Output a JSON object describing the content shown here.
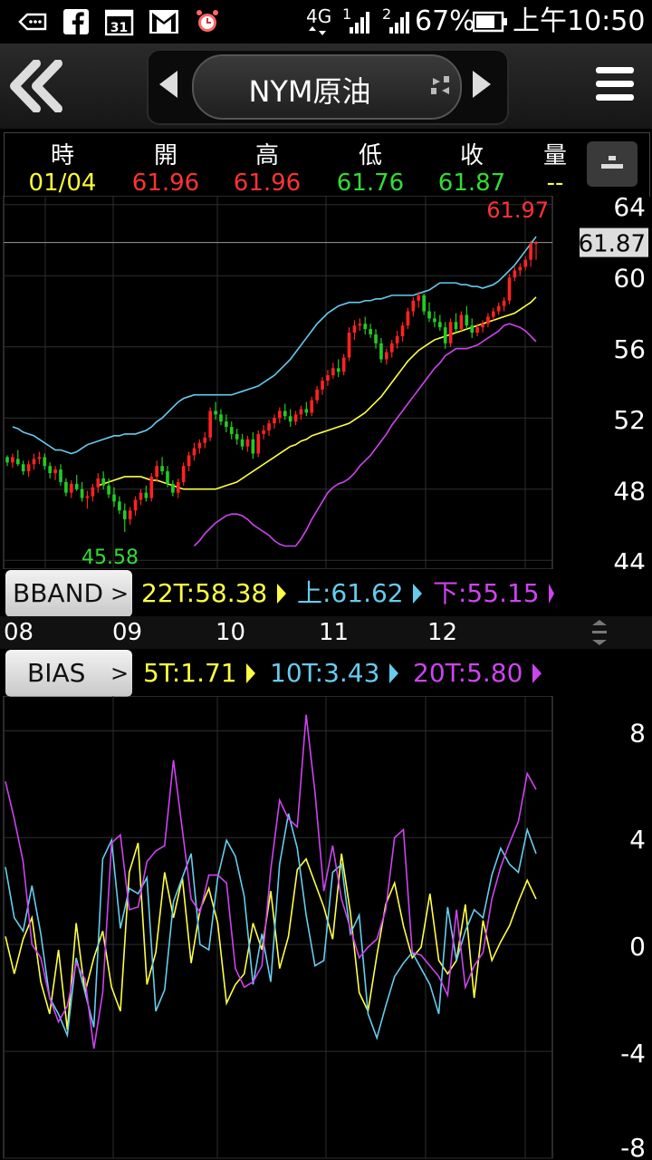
{
  "status_bar": {
    "network": "4G",
    "sim1": "1",
    "sim2": "2",
    "battery": "67%",
    "time": "上午10:50",
    "icons": [
      "cast-icon",
      "facebook-icon",
      "calendar-icon",
      "gmail-icon",
      "alarm-icon"
    ],
    "calendar_day": "31"
  },
  "app_bar": {
    "title": "NYM原油"
  },
  "quote": {
    "headers": [
      "時",
      "開",
      "高",
      "低",
      "收",
      "量"
    ],
    "values": [
      "01/04",
      "61.96",
      "61.96",
      "61.76",
      "61.87",
      "--"
    ],
    "colors": [
      "#ffff33",
      "#ff3333",
      "#ff3333",
      "#33dd33",
      "#33dd33",
      "#ffff33"
    ]
  },
  "bband": {
    "button_label": "BBAND",
    "mid_label": "22T:58.38",
    "up_label": "上:61.62",
    "down_label": "下:55.15",
    "colors": {
      "mid": "#ffff44",
      "up": "#66ccee",
      "down": "#cc44ee"
    }
  },
  "months": [
    "08",
    "09",
    "10",
    "11",
    "12"
  ],
  "bias": {
    "button_label": "BIAS",
    "t5_label": "5T:1.71",
    "t10_label": "10T:3.43",
    "t20_label": "20T:5.80"
  },
  "chart_data": [
    {
      "type": "candlestick",
      "high_label": "61.97",
      "low_label": "45.58",
      "last_price": "61.87",
      "last_value": 61.87,
      "y_ticks": [
        64,
        60,
        56,
        52,
        48,
        44
      ],
      "ylim": [
        43.5,
        64.5
      ],
      "grid": true,
      "up_color": "#ff2222",
      "down_color": "#22cc22",
      "candles": [
        [
          49.8,
          49.9,
          49.3,
          49.5
        ],
        [
          49.5,
          50.0,
          49.2,
          49.8
        ],
        [
          49.7,
          50.2,
          49.3,
          49.4
        ],
        [
          49.4,
          49.6,
          48.8,
          49.0
        ],
        [
          49.0,
          49.6,
          48.7,
          49.4
        ],
        [
          49.4,
          50.0,
          49.1,
          49.7
        ],
        [
          49.7,
          50.1,
          49.4,
          49.8
        ],
        [
          49.8,
          50.0,
          49.1,
          49.3
        ],
        [
          49.3,
          49.5,
          48.6,
          48.9
        ],
        [
          48.9,
          49.3,
          48.5,
          49.1
        ],
        [
          49.1,
          49.4,
          48.2,
          48.4
        ],
        [
          48.4,
          48.6,
          47.6,
          47.8
        ],
        [
          47.8,
          48.5,
          47.5,
          48.3
        ],
        [
          48.3,
          48.8,
          47.9,
          48.0
        ],
        [
          48.0,
          48.4,
          47.3,
          47.5
        ],
        [
          47.5,
          47.9,
          46.9,
          47.6
        ],
        [
          47.6,
          48.3,
          47.3,
          48.1
        ],
        [
          48.1,
          48.9,
          47.8,
          48.6
        ],
        [
          48.6,
          49.0,
          48.0,
          48.2
        ],
        [
          48.2,
          48.6,
          47.5,
          47.7
        ],
        [
          47.7,
          48.1,
          47.0,
          47.3
        ],
        [
          47.3,
          47.6,
          46.6,
          46.8
        ],
        [
          46.8,
          47.2,
          45.58,
          46.3
        ],
        [
          46.3,
          47.0,
          46.0,
          46.8
        ],
        [
          46.8,
          47.6,
          46.5,
          47.4
        ],
        [
          47.4,
          48.0,
          47.1,
          47.8
        ],
        [
          47.8,
          48.2,
          47.3,
          47.5
        ],
        [
          47.5,
          48.9,
          47.3,
          48.7
        ],
        [
          48.7,
          49.6,
          48.4,
          49.3
        ],
        [
          49.3,
          49.8,
          48.8,
          49.0
        ],
        [
          49.0,
          49.3,
          48.1,
          48.3
        ],
        [
          48.3,
          48.5,
          47.6,
          47.8
        ],
        [
          47.8,
          48.6,
          47.5,
          48.4
        ],
        [
          48.4,
          49.5,
          48.2,
          49.3
        ],
        [
          49.3,
          50.1,
          49.0,
          49.9
        ],
        [
          49.9,
          50.6,
          49.6,
          50.3
        ],
        [
          50.3,
          50.8,
          50.0,
          50.6
        ],
        [
          50.6,
          51.2,
          50.3,
          50.9
        ],
        [
          50.9,
          52.6,
          50.7,
          52.4
        ],
        [
          52.4,
          52.9,
          51.9,
          52.2
        ],
        [
          52.2,
          52.5,
          51.6,
          51.8
        ],
        [
          51.8,
          52.2,
          51.2,
          51.5
        ],
        [
          51.5,
          51.8,
          50.8,
          51.1
        ],
        [
          51.1,
          51.4,
          50.5,
          50.8
        ],
        [
          50.8,
          51.1,
          50.2,
          50.4
        ],
        [
          50.4,
          51.0,
          50.1,
          50.8
        ],
        [
          50.8,
          51.2,
          49.7,
          50.0
        ],
        [
          50.0,
          51.3,
          49.8,
          51.1
        ],
        [
          51.1,
          51.6,
          50.8,
          51.3
        ],
        [
          51.3,
          51.9,
          51.0,
          51.7
        ],
        [
          51.7,
          52.2,
          51.4,
          52.0
        ],
        [
          52.0,
          52.6,
          51.7,
          52.4
        ],
        [
          52.4,
          52.8,
          51.9,
          52.1
        ],
        [
          52.1,
          52.5,
          51.5,
          51.8
        ],
        [
          51.8,
          52.4,
          51.6,
          52.2
        ],
        [
          52.2,
          52.7,
          51.9,
          52.5
        ],
        [
          52.5,
          52.9,
          52.1,
          52.3
        ],
        [
          52.3,
          53.2,
          52.1,
          53.0
        ],
        [
          53.0,
          53.8,
          52.8,
          53.6
        ],
        [
          53.6,
          54.3,
          53.3,
          54.1
        ],
        [
          54.1,
          54.7,
          53.8,
          54.4
        ],
        [
          54.4,
          55.1,
          54.2,
          54.8
        ],
        [
          54.8,
          55.3,
          54.3,
          54.6
        ],
        [
          54.6,
          55.6,
          54.4,
          55.4
        ],
        [
          55.4,
          57.1,
          55.2,
          56.8
        ],
        [
          56.8,
          57.5,
          56.4,
          57.2
        ],
        [
          57.2,
          57.6,
          56.9,
          57.3
        ],
        [
          57.3,
          57.7,
          56.7,
          57.0
        ],
        [
          57.0,
          57.3,
          56.5,
          56.7
        ],
        [
          56.7,
          57.0,
          55.9,
          56.2
        ],
        [
          56.2,
          56.5,
          55.1,
          55.3
        ],
        [
          55.3,
          55.9,
          55.0,
          55.7
        ],
        [
          55.7,
          56.4,
          55.4,
          56.2
        ],
        [
          56.2,
          56.9,
          55.9,
          56.6
        ],
        [
          56.6,
          57.4,
          56.3,
          57.2
        ],
        [
          57.2,
          58.2,
          57.0,
          58.0
        ],
        [
          58.0,
          58.8,
          57.7,
          58.6
        ],
        [
          58.6,
          59.1,
          58.2,
          58.9
        ],
        [
          58.9,
          59.0,
          57.8,
          58.0
        ],
        [
          58.0,
          58.5,
          57.4,
          57.6
        ],
        [
          57.6,
          58.0,
          57.1,
          57.4
        ],
        [
          57.4,
          57.8,
          56.9,
          57.1
        ],
        [
          57.1,
          57.4,
          55.9,
          56.2
        ],
        [
          56.2,
          57.6,
          56.0,
          57.4
        ],
        [
          57.4,
          57.9,
          56.8,
          57.0
        ],
        [
          57.0,
          58.0,
          56.9,
          57.8
        ],
        [
          57.8,
          58.3,
          57.0,
          57.2
        ],
        [
          57.2,
          57.6,
          56.5,
          56.8
        ],
        [
          56.8,
          57.3,
          56.6,
          57.1
        ],
        [
          57.1,
          57.5,
          56.8,
          57.3
        ],
        [
          57.3,
          57.9,
          57.1,
          57.7
        ],
        [
          57.7,
          58.2,
          57.5,
          58.0
        ],
        [
          58.0,
          58.5,
          57.8,
          58.3
        ],
        [
          58.3,
          58.8,
          58.0,
          58.6
        ],
        [
          58.6,
          60.1,
          58.4,
          59.9
        ],
        [
          59.9,
          60.5,
          59.7,
          60.3
        ],
        [
          60.3,
          60.7,
          60.0,
          60.5
        ],
        [
          60.5,
          61.1,
          60.3,
          60.9
        ],
        [
          60.9,
          61.97,
          60.5,
          61.8
        ],
        [
          61.8,
          61.96,
          60.9,
          61.87
        ]
      ],
      "upper_band": [
        51.5,
        51.4,
        51.2,
        51.1,
        51.0,
        50.8,
        50.6,
        50.4,
        50.2,
        50.2,
        50.1,
        50.0,
        50.1,
        50.3,
        50.5,
        50.6,
        50.7,
        50.8,
        50.9,
        51.0,
        51.0,
        51.1,
        51.1,
        51.1,
        51.2,
        51.3,
        51.5,
        51.8,
        52.0,
        52.3,
        52.6,
        52.9,
        53.1,
        53.2,
        53.3,
        53.3,
        53.3,
        53.3,
        53.3,
        53.3,
        53.3,
        53.3,
        53.4,
        53.5,
        53.6,
        53.7,
        53.8,
        54.0,
        54.2,
        54.4,
        54.7,
        55.0,
        55.3,
        55.7,
        56.1,
        56.5,
        56.9,
        57.3,
        57.6,
        57.9,
        58.1,
        58.3,
        58.4,
        58.5,
        58.5,
        58.5,
        58.6,
        58.6,
        58.7,
        58.7,
        58.8,
        58.9,
        58.9,
        58.9,
        58.9,
        58.9,
        59.0,
        59.1,
        59.2,
        59.4,
        59.6,
        59.6,
        59.6,
        59.6,
        59.5,
        59.5,
        59.4,
        59.4,
        59.3,
        59.4,
        59.5,
        59.7,
        60.0,
        60.3,
        60.6,
        61.0,
        61.4,
        61.8,
        62.2
      ],
      "mid_band": [
        48.2,
        48.3,
        48.4,
        48.5,
        48.6,
        48.7,
        48.7,
        48.7,
        48.7,
        48.6,
        48.5,
        48.5,
        48.4,
        48.3,
        48.2,
        48.1,
        48.0,
        48.0,
        48.0,
        48.0,
        48.0,
        48.0,
        48.0,
        48.1,
        48.2,
        48.3,
        48.4,
        48.6,
        48.8,
        49.0,
        49.2,
        49.4,
        49.6,
        49.8,
        50.0,
        50.2,
        50.4,
        50.5,
        50.7,
        50.8,
        51.0,
        51.1,
        51.2,
        51.3,
        51.4,
        51.5,
        51.6,
        51.7,
        51.9,
        52.1,
        52.3,
        52.6,
        52.9,
        53.2,
        53.6,
        54.0,
        54.4,
        54.8,
        55.2,
        55.5,
        55.8,
        56.0,
        56.2,
        56.4,
        56.5,
        56.6,
        56.7,
        56.8,
        56.9,
        57.0,
        57.1,
        57.2,
        57.3,
        57.4,
        57.5,
        57.6,
        57.7,
        57.8,
        57.9,
        58.1,
        58.3,
        58.5,
        58.8
      ],
      "lower_band": [
        44.8,
        45.1,
        45.5,
        45.8,
        46.1,
        46.3,
        46.5,
        46.6,
        46.6,
        46.5,
        46.3,
        46.0,
        45.8,
        45.6,
        45.4,
        45.1,
        44.9,
        44.8,
        44.8,
        44.8,
        45.2,
        45.7,
        46.3,
        46.8,
        47.3,
        47.8,
        48.1,
        48.3,
        48.4,
        48.6,
        48.9,
        49.3,
        49.6,
        49.9,
        50.3,
        50.7,
        51.1,
        51.6,
        52.0,
        52.4,
        52.8,
        53.2,
        53.6,
        54.0,
        54.4,
        54.8,
        55.1,
        55.5,
        55.7,
        55.9,
        55.9,
        55.9,
        56.0,
        56.1,
        56.3,
        56.5,
        56.7,
        56.9,
        57.2,
        57.3,
        57.2,
        57.1,
        56.9,
        56.6,
        56.3
      ]
    },
    {
      "type": "line",
      "y_ticks": [
        8,
        4,
        0,
        -4,
        -8
      ],
      "ylim": [
        -8,
        9.3
      ],
      "grid": true,
      "series": [
        {
          "name": "5T",
          "color": "#ffff44",
          "values": [
            0.3,
            -1.1,
            0.2,
            1.0,
            -1.4,
            -2.6,
            -0.2,
            -3.2,
            0.8,
            -1.8,
            -0.5,
            0.5,
            -1.6,
            -2.5,
            2.7,
            3.8,
            -1.5,
            -0.3,
            2.7,
            1.0,
            2.5,
            -0.7,
            1.3,
            2.1,
            0.8,
            -2.2,
            -1.5,
            -1.1,
            0.8,
            -0.2,
            2.0,
            -0.9,
            0.3,
            2.8,
            3.2,
            2.3,
            1.4,
            0.2,
            3.4,
            1.2,
            -1.8,
            -2.5,
            -0.4,
            1.5,
            2.3,
            0.7,
            -0.5,
            -0.1,
            1.9,
            -0.6,
            -1.1,
            -0.6,
            1.5,
            -2.0,
            0.9,
            -0.6,
            0.1,
            0.7,
            1.6,
            2.4,
            1.7
          ]
        },
        {
          "name": "10T",
          "color": "#66ccee",
          "values": [
            2.9,
            1.0,
            0.5,
            2.2,
            0.4,
            -2.0,
            -2.6,
            -3.4,
            -0.5,
            -1.8,
            -3.1,
            3.2,
            3.9,
            0.6,
            2.1,
            1.9,
            2.5,
            -2.5,
            -1.7,
            1.6,
            2.5,
            3.4,
            0.0,
            -0.2,
            2.5,
            3.9,
            3.3,
            1.8,
            -1.5,
            0.4,
            -1.4,
            3.0,
            4.9,
            3.6,
            1.1,
            -0.8,
            -0.6,
            2.7,
            3.0,
            0.4,
            1.1,
            -2.6,
            -3.5,
            -2.3,
            -1.2,
            -0.7,
            -0.3,
            -0.9,
            -1.5,
            -2.6,
            1.4,
            -0.6,
            0.5,
            1.3,
            1.0,
            2.6,
            3.6,
            3.0,
            2.7,
            4.3,
            3.4
          ]
        },
        {
          "name": "20T",
          "color": "#cc44ee",
          "values": [
            6.1,
            4.7,
            3.1,
            0.0,
            -0.5,
            -2.0,
            -2.9,
            -2.3,
            -0.7,
            -1.3,
            -3.9,
            -1.8,
            3.8,
            4.1,
            1.3,
            1.4,
            3.1,
            3.5,
            3.7,
            6.9,
            4.3,
            1.7,
            1.2,
            2.6,
            2.6,
            2.3,
            -0.9,
            -1.6,
            -1.4,
            -0.8,
            2.8,
            5.4,
            4.7,
            4.4,
            8.6,
            5.7,
            2.0,
            3.7,
            1.7,
            0.6,
            -0.5,
            -0.1,
            0.2,
            1.3,
            4.0,
            4.3,
            -0.3,
            -0.4,
            -0.8,
            -1.2,
            -1.9,
            1.3,
            -1.6,
            -0.8,
            -0.3,
            1.7,
            2.9,
            3.8,
            4.6,
            6.4,
            5.8
          ]
        }
      ]
    }
  ]
}
